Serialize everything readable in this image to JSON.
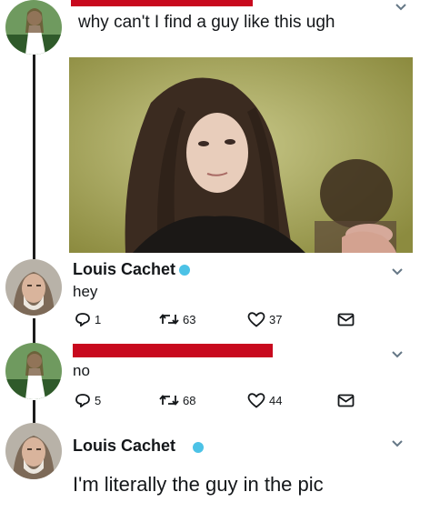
{
  "tweet1": {
    "text": "why can't I find a guy like this ugh",
    "photo": {
      "description_icon": "photo-icon"
    }
  },
  "tweet2": {
    "display_name": "Louis Cachet",
    "text": "hey",
    "actions": {
      "replies": "1",
      "retweets": "63",
      "likes": "37"
    }
  },
  "tweet3": {
    "text": "no",
    "actions": {
      "replies": "5",
      "retweets": "68",
      "likes": "44"
    }
  },
  "tweet4": {
    "display_name": "Louis Cachet",
    "text": "I'm literally the guy in the pic"
  },
  "colors": {
    "verified": "#4cc2e6",
    "redaction": "#c8091e",
    "thread_line": "#1c1c1c"
  }
}
